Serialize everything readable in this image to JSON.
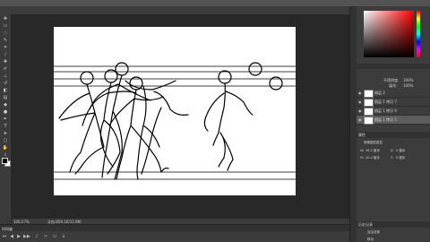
{
  "colors": {
    "canvas": "#ffffff",
    "workspace": "#282828",
    "panel": "#3c3c3c"
  },
  "tools": [
    "move-icon",
    "marquee-icon",
    "lasso-icon",
    "quick-select-icon",
    "crop-icon",
    "eyedropper-icon",
    "healing-icon",
    "brush-icon",
    "stamp-icon",
    "history-brush-icon",
    "eraser-icon",
    "gradient-icon",
    "blur-icon",
    "dodge-icon",
    "pen-icon",
    "type-icon",
    "path-select-icon",
    "shape-icon",
    "hand-icon",
    "zoom-icon"
  ],
  "status": {
    "zoom": "106.57%",
    "doc": "文档:859.1K/12.9M"
  },
  "timeline": {
    "tab": "时间轴"
  },
  "layers": {
    "opacity_label": "不透明度:",
    "opacity": "100%",
    "fill_label": "填充:",
    "fill": "100%",
    "items": [
      {
        "name": "图层 2"
      },
      {
        "name": "图层 1 拷贝 7"
      },
      {
        "name": "图层 1 拷贝 6"
      },
      {
        "name": "图层 1 拷贝 5"
      }
    ]
  },
  "properties": {
    "tab": "属性",
    "subtitle": "像素图层属性",
    "w_label": "W:",
    "w": "36.2 厘米",
    "h_label": "H:",
    "h": "20.4 厘米",
    "x_label": "X:",
    "x": "0 厘米",
    "y_label": "Y:",
    "y": "0 厘米"
  },
  "history": {
    "tab": "历史记录",
    "items": [
      "自由变换",
      "移动"
    ]
  }
}
